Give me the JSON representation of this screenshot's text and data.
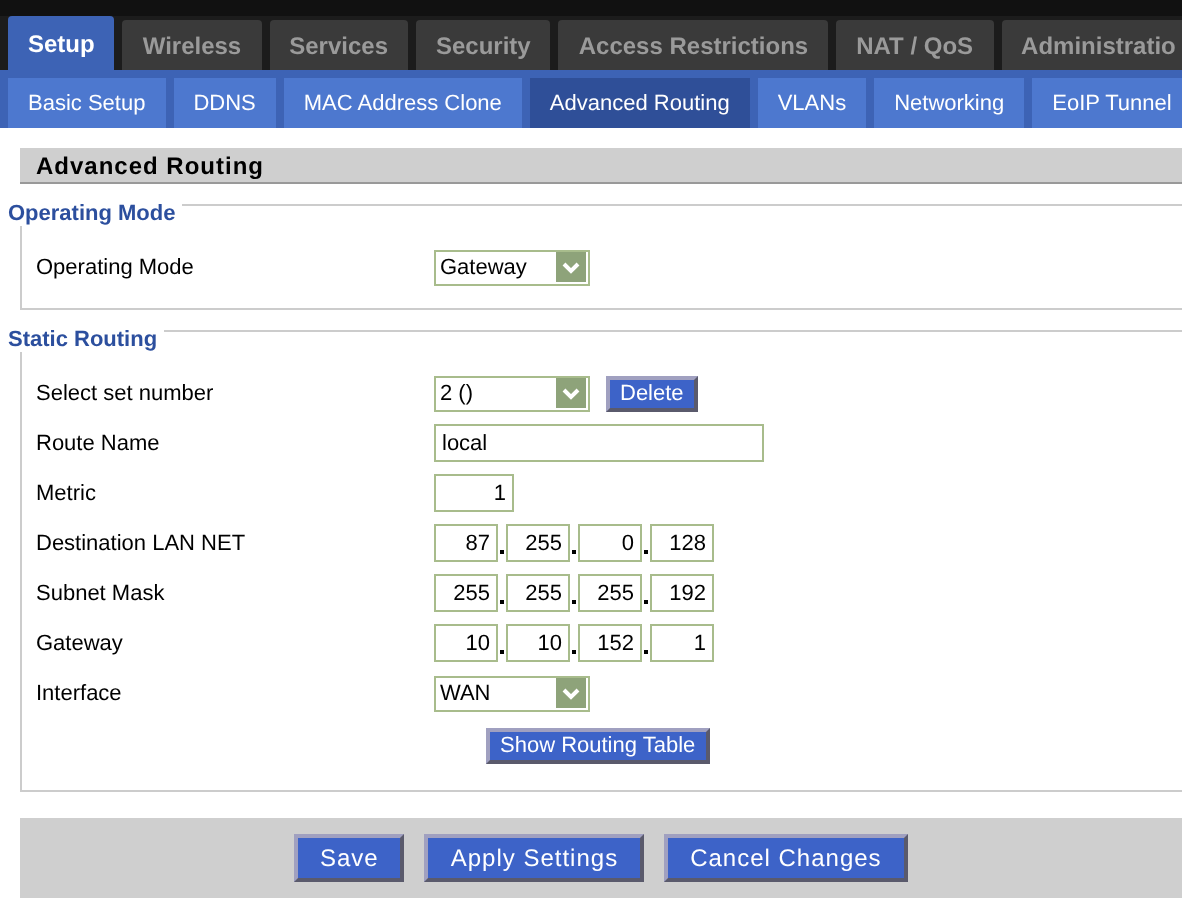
{
  "top_tabs": [
    {
      "label": "Setup",
      "selected": true
    },
    {
      "label": "Wireless",
      "selected": false
    },
    {
      "label": "Services",
      "selected": false
    },
    {
      "label": "Security",
      "selected": false
    },
    {
      "label": "Access Restrictions",
      "selected": false
    },
    {
      "label": "NAT / QoS",
      "selected": false
    },
    {
      "label": "Administratio",
      "selected": false
    }
  ],
  "sub_tabs": [
    {
      "label": "Basic Setup",
      "selected": false
    },
    {
      "label": "DDNS",
      "selected": false
    },
    {
      "label": "MAC Address Clone",
      "selected": false
    },
    {
      "label": "Advanced Routing",
      "selected": true
    },
    {
      "label": "VLANs",
      "selected": false
    },
    {
      "label": "Networking",
      "selected": false
    },
    {
      "label": "EoIP Tunnel",
      "selected": false
    }
  ],
  "page_title": "Advanced Routing",
  "sections": [
    {
      "legend": "Operating Mode",
      "rows": [
        {
          "kind": "select",
          "label": "Operating Mode",
          "value": "Gateway"
        }
      ]
    },
    {
      "legend": "Static Routing",
      "rows": [
        {
          "kind": "select",
          "label": "Select set number",
          "value": "2 ()",
          "button": "Delete"
        },
        {
          "kind": "text",
          "label": "Route Name",
          "value": "local"
        },
        {
          "kind": "number",
          "label": "Metric",
          "value": "1"
        },
        {
          "kind": "ip",
          "label": "Destination LAN NET",
          "octets": [
            "87",
            "255",
            "0",
            "128"
          ]
        },
        {
          "kind": "ip",
          "label": "Subnet Mask",
          "octets": [
            "255",
            "255",
            "255",
            "192"
          ]
        },
        {
          "kind": "ip",
          "label": "Gateway",
          "octets": [
            "10",
            "10",
            "152",
            "1"
          ]
        },
        {
          "kind": "select",
          "label": "Interface",
          "value": "WAN"
        },
        {
          "kind": "action",
          "button": "Show Routing Table"
        }
      ]
    }
  ],
  "footer_buttons": [
    "Save",
    "Apply Settings",
    "Cancel Changes"
  ]
}
